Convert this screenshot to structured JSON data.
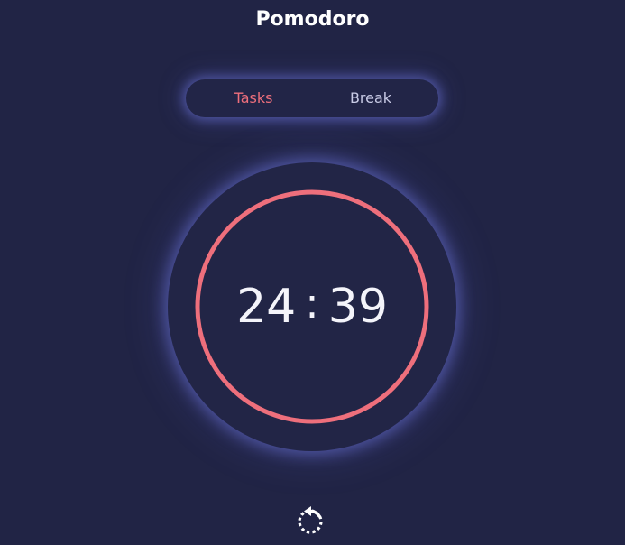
{
  "app": {
    "title": "Pomodoro"
  },
  "modes": {
    "tasks_label": "Tasks",
    "break_label": "Break",
    "active": "tasks"
  },
  "timer": {
    "minutes": "24",
    "separator": ":",
    "seconds": "39",
    "progress_fraction": 1.0
  },
  "controls": {
    "restart_icon": "restart-icon"
  },
  "colors": {
    "background": "#212445",
    "accent": "#ee6f7c",
    "text": "#ffffff",
    "inactive_text": "#c9cbe6",
    "glow": "#6e76dc"
  }
}
